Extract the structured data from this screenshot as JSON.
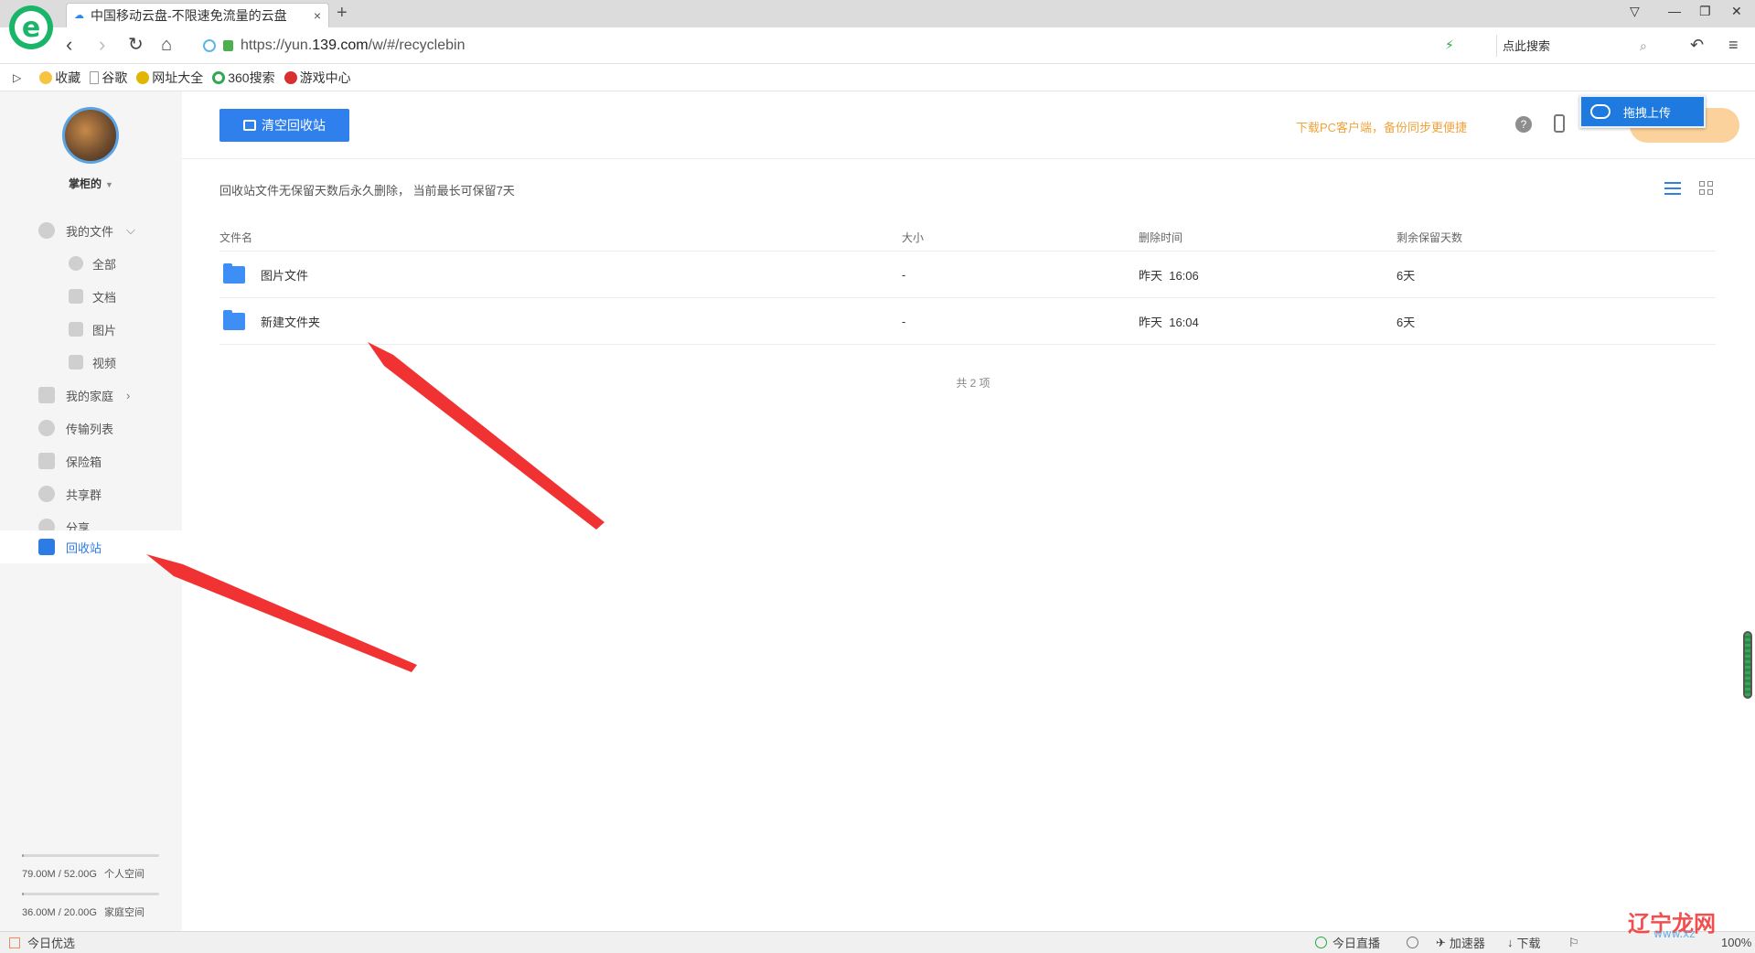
{
  "browser": {
    "tab_title": "中国移动云盘-不限速免流量的云盘",
    "tab_close": "×",
    "new_tab": "+",
    "url_prefix": "https://yun.",
    "url_domain": "139.com",
    "url_path": "/w/#/recyclebin",
    "search_placeholder": "点此搜索",
    "bookmarks": [
      {
        "label": "收藏",
        "icon": "star-icon"
      },
      {
        "label": "谷歌",
        "icon": "page-icon"
      },
      {
        "label": "网址大全",
        "icon": "globe-icon"
      },
      {
        "label": "360搜索",
        "icon": "search-360-icon"
      },
      {
        "label": "游戏中心",
        "icon": "game-icon"
      }
    ]
  },
  "sidebar": {
    "username": "掌柜的",
    "items": [
      {
        "label": "我的文件",
        "icon": "cloud-icon"
      },
      {
        "label": "全部",
        "icon": "grid-icon"
      },
      {
        "label": "文档",
        "icon": "doc-icon"
      },
      {
        "label": "图片",
        "icon": "image-icon"
      },
      {
        "label": "视频",
        "icon": "video-icon"
      },
      {
        "label": "我的家庭",
        "icon": "heart-icon"
      },
      {
        "label": "传输列表",
        "icon": "transfer-icon"
      },
      {
        "label": "保险箱",
        "icon": "safe-icon"
      },
      {
        "label": "共享群",
        "icon": "group-icon"
      },
      {
        "label": "分享",
        "icon": "share-icon"
      },
      {
        "label": "回收站",
        "icon": "trash-icon"
      }
    ],
    "quota_personal": {
      "used": "79.00M / 52.00G",
      "label": "个人空间",
      "fraction": 0.0015
    },
    "quota_family": {
      "used": "36.00M / 20.00G",
      "label": "家庭空间",
      "fraction": 0.0018
    }
  },
  "main": {
    "empty_button": "清空回收站",
    "pc_download": "下载PC客户端，备份同步更便捷",
    "help": "?",
    "drag_upload": "拖拽上传",
    "notice": "回收站文件无保留天数后永久删除， 当前最长可保留7天",
    "columns": {
      "name": "文件名",
      "size": "大小",
      "time": "删除时间",
      "days": "剩余保留天数"
    },
    "rows": [
      {
        "name": "图片文件",
        "size": "-",
        "time": "昨天  16:06",
        "days": "6天"
      },
      {
        "name": "新建文件夹",
        "size": "-",
        "time": "昨天  16:04",
        "days": "6天"
      }
    ],
    "total": "共 2 项"
  },
  "statusbar": {
    "left": "今日优选",
    "live": "今日直播",
    "accelerator": "加速器",
    "download": "下载",
    "zoom": "100%"
  },
  "watermark": {
    "text": "辽宁龙网",
    "url": "www.xz"
  },
  "colors": {
    "accent": "#2f80ed",
    "orange": "#f0a33c",
    "arrow": "#f03232"
  }
}
